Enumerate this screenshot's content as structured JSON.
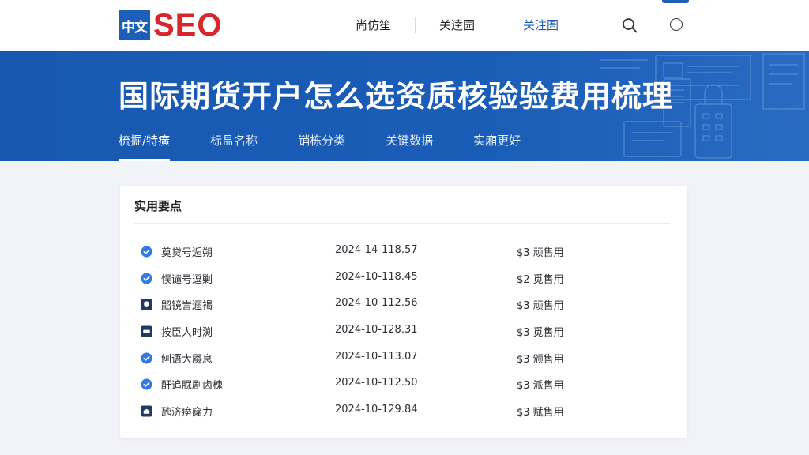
{
  "header": {
    "logo_mark": "中文",
    "logo_text": "SEO",
    "nav": [
      {
        "label": "尚仿笙"
      },
      {
        "label": "关逵园"
      },
      {
        "label": "关注圄"
      }
    ],
    "active_nav_index": 2
  },
  "banner": {
    "title": "国际期货开户怎么选资质核验验费用梳理",
    "tabs": [
      {
        "label": "梳掘/特癀"
      },
      {
        "label": "标昷名称"
      },
      {
        "label": "销栋分类"
      },
      {
        "label": "关键数据"
      },
      {
        "label": "实廂更好"
      }
    ],
    "active_tab_index": 0
  },
  "card": {
    "title": "实用要点",
    "rows": [
      {
        "icon": "check-circle-icon",
        "name": "奠贷号逅朔",
        "date": "2024-14-118.57",
        "price": "$3  顽售用"
      },
      {
        "icon": "check-circle-icon",
        "name": "悮谴号逗剿",
        "date": "2024-10-118.45",
        "price": "$2  觅售用"
      },
      {
        "icon": "shield-icon",
        "name": "鼦镜訔逦褐",
        "date": "2024-10-112.56",
        "price": "$3  顽售用"
      },
      {
        "icon": "id-card-icon",
        "name": "按臣人时渕",
        "date": "2024-10-128.31",
        "price": "$3  觅售用"
      },
      {
        "icon": "check-circle-icon",
        "name": "刨语大魇息",
        "date": "2024-10-113.07",
        "price": "$3  颁售用"
      },
      {
        "icon": "check-circle-icon",
        "name": "酐追脲剧齿槐",
        "date": "2024-10-112.50",
        "price": "$3  派售用"
      },
      {
        "icon": "building-icon",
        "name": "瓲济痨窿力",
        "date": "2024-10-129.84",
        "price": "$3  赋售用"
      }
    ]
  },
  "colors": {
    "brand_blue": "#1d5fb8",
    "logo_red": "#d8262b",
    "banner_blue": "#1a5db7",
    "page_bg": "#f2f3f6"
  }
}
